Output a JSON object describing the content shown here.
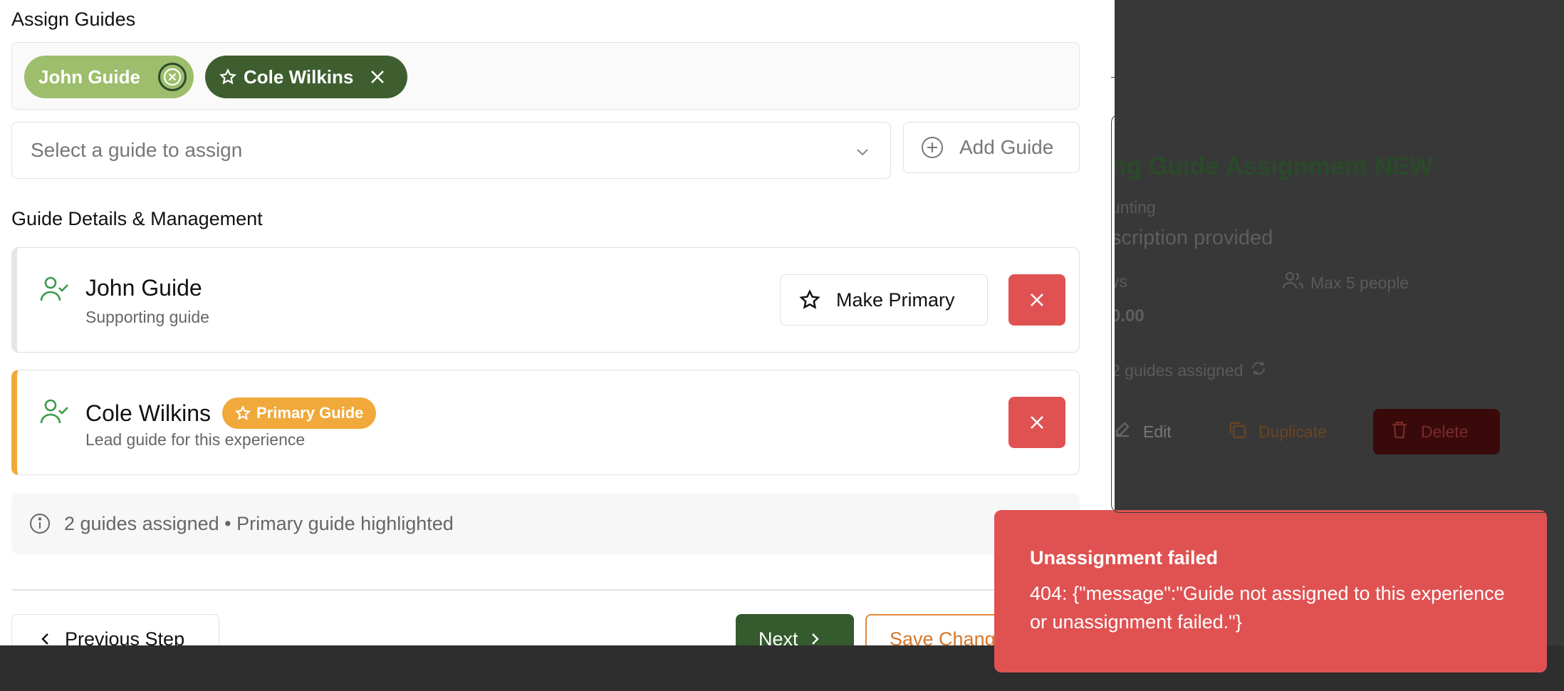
{
  "background_page": {
    "title": "ng Guide Assignment NEW",
    "category": "unting",
    "description": "scription provided",
    "duration": "ys",
    "max_people": "Max 5 people",
    "price": "0.00",
    "guides_assigned": "2 guides assigned",
    "edit_label": "Edit",
    "duplicate_label": "Duplicate",
    "delete_label": "Delete"
  },
  "assign_guides": {
    "heading": "Assign Guides",
    "chips": [
      {
        "label": "John Guide"
      },
      {
        "label": "Cole Wilkins"
      }
    ],
    "select_placeholder": "Select a guide to assign",
    "add_guide_label": "Add Guide"
  },
  "guide_details": {
    "heading": "Guide Details & Management",
    "guides": [
      {
        "name": "John Guide",
        "role": "Supporting guide",
        "make_primary_label": "Make Primary"
      },
      {
        "name": "Cole Wilkins",
        "role": "Lead guide for this experience",
        "badge": "Primary Guide"
      }
    ],
    "info_text": "2 guides assigned • Primary guide highlighted"
  },
  "footer": {
    "previous_label": "Previous Step",
    "next_label": "Next",
    "save_label": "Save Changes"
  },
  "toast": {
    "title": "Unassignment failed",
    "message": "404: {\"message\":\"Guide not assigned to this experience or unassignment failed.\"}"
  },
  "colors": {
    "primary_green": "#345a2d",
    "chip_light_green": "#9dbe6c",
    "primary_badge": "#f0a93a",
    "danger": "#e05252",
    "save_orange": "#d4772a"
  }
}
